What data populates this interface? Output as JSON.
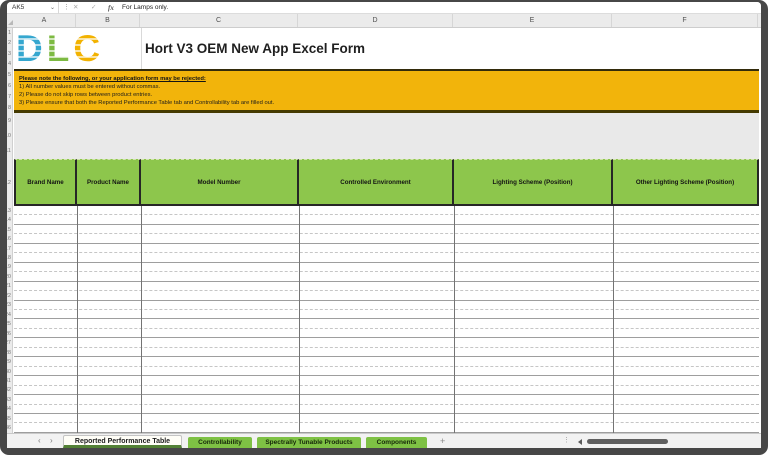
{
  "formula_bar": {
    "name_box": "AK5",
    "name_box_chevron": "⌄",
    "cancel_icon": "✕",
    "enter_icon": "✓",
    "fx_icon": "fx",
    "separator_dots": "⋮",
    "formula": "For Lamps only."
  },
  "column_headers": [
    "A",
    "B",
    "C",
    "D",
    "E",
    "F"
  ],
  "sheet": {
    "title": "Hort V3 OEM New App Excel Form",
    "logo_letters": [
      {
        "char": "D",
        "color": "#35A7CF"
      },
      {
        "char": "L",
        "color": "#7DBA42"
      },
      {
        "char": "C",
        "color": "#F2B200"
      }
    ],
    "notice": {
      "heading": "Please note the following, or your application form may be rejected:",
      "lines": [
        "1) All number values must be entered without commas.",
        "2) Please do not skip rows between product entries.",
        "3) Please ensure that both the Reported Performance Table tab and Controllability tab are filled out."
      ],
      "bg_color": "#F2B40B"
    },
    "table": {
      "headers": [
        "Brand Name",
        "Product Name",
        "Model Number",
        "Controlled Environment",
        "Lighting Scheme (Position)",
        "Other Lighting Scheme (Position)"
      ],
      "header_bg_color": "#8DC64C",
      "data_row_count": 24
    }
  },
  "sheet_tabs": {
    "nav_prev": "‹",
    "nav_next": "›",
    "tabs": [
      {
        "label": "Reported Performance Table",
        "active": true
      },
      {
        "label": "Controllability",
        "active": false
      },
      {
        "label": "Spectrally Tunable Products",
        "active": false
      },
      {
        "label": "Components",
        "active": false
      }
    ],
    "add_sheet": "+",
    "separator_dots": "⋮",
    "active_underline_color": "#538135"
  }
}
